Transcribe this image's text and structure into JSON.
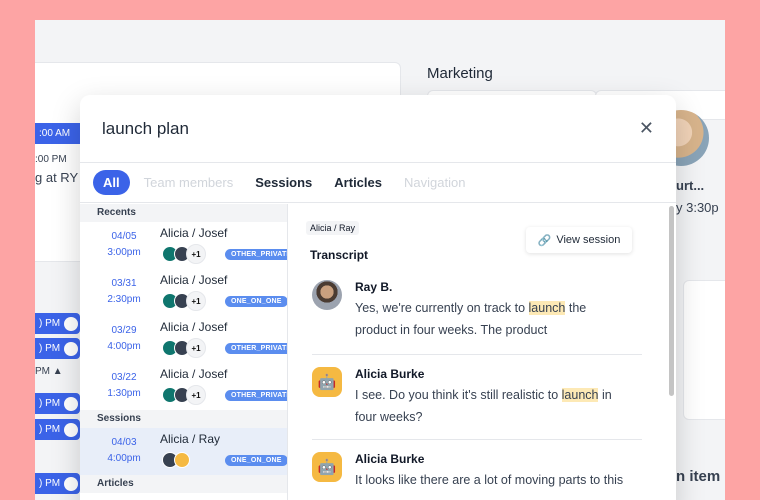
{
  "background": {
    "heading": "Marketing",
    "time_left_1": ":00 AM",
    "time_left_2": ":00 PM",
    "text_left": "g at RY",
    "text_right_1": "urt...",
    "text_right_2": "y 3:30p",
    "text_right_3": "n item",
    "blue_rows": [
      ") PM",
      ") PM",
      ") PM",
      ") PM",
      ") PM",
      ") PM"
    ],
    "plain_row": "PM"
  },
  "search": {
    "value": "launch plan"
  },
  "tabs": [
    {
      "label": "All"
    },
    {
      "label": "Team members"
    },
    {
      "label": "Sessions"
    },
    {
      "label": "Articles"
    },
    {
      "label": "Navigation"
    }
  ],
  "recents_heading": "Recents",
  "sessions_heading": "Sessions",
  "articles_heading": "Articles",
  "recents": [
    {
      "date": "04/05",
      "time": "3:00pm",
      "title": "Alicia / Josef",
      "badge": "OTHER_PRIVATE"
    },
    {
      "date": "03/31",
      "time": "2:30pm",
      "title": "Alicia / Josef",
      "badge": "ONE_ON_ONE"
    },
    {
      "date": "03/29",
      "time": "4:00pm",
      "title": "Alicia / Josef",
      "badge": "OTHER_PRIVATE"
    },
    {
      "date": "03/22",
      "time": "1:30pm",
      "title": "Alicia / Josef",
      "badge": "OTHER_PRIVATE"
    }
  ],
  "sessions": [
    {
      "date": "04/03",
      "time": "4:00pm",
      "title": "Alicia / Ray",
      "badge": "ONE_ON_ONE"
    }
  ],
  "preview": {
    "crumb": "Alicia / Ray",
    "section": "Transcript",
    "view_button": "View session",
    "messages": [
      {
        "name": "Ray B.",
        "pre": "Yes, we're currently on track to ",
        "hl": "launch",
        "post": " the product in four weeks. The product"
      },
      {
        "name": "Alicia Burke",
        "pre": "I see. Do you think it's still realistic to ",
        "hl": "launch",
        "post": " in four weeks?"
      },
      {
        "name": "Alicia Burke",
        "pre": "It looks like there are a lot of moving parts to this",
        "hl": "",
        "post": ""
      }
    ]
  }
}
